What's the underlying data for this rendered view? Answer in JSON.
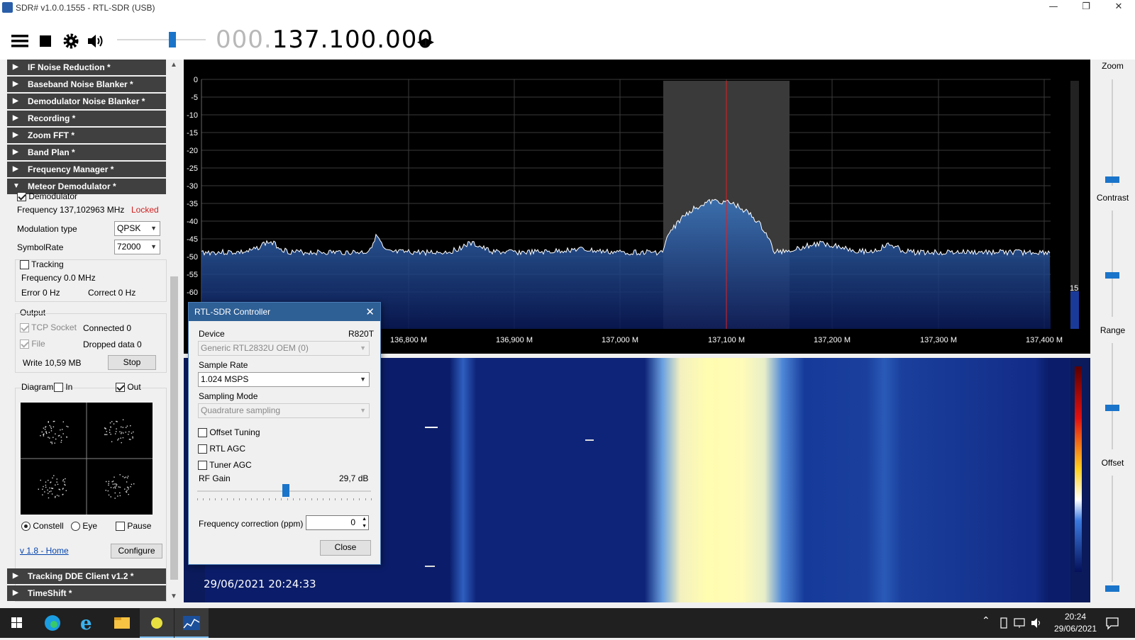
{
  "window": {
    "title": "SDR# v1.0.0.1555 - RTL-SDR (USB)",
    "controls": [
      "—",
      "❐",
      "✕"
    ]
  },
  "toolbar": {
    "icons": [
      "menu-icon",
      "stop-icon",
      "gear-icon",
      "speaker-icon"
    ],
    "frequency_dim": "000.",
    "frequency_main": "137.100.000",
    "tune_arrows": "◂▸"
  },
  "left_panel": {
    "sections_top": [
      {
        "label": "IF Noise Reduction *",
        "expanded": false
      },
      {
        "label": "Baseband Noise Blanker *",
        "expanded": false
      },
      {
        "label": "Demodulator Noise Blanker *",
        "expanded": false
      },
      {
        "label": "Recording *",
        "expanded": false
      },
      {
        "label": "Zoom FFT *",
        "expanded": false
      },
      {
        "label": "Band Plan *",
        "expanded": false
      },
      {
        "label": "Frequency Manager *",
        "expanded": false
      },
      {
        "label": "Meteor Demodulator *",
        "expanded": true
      }
    ],
    "meteor": {
      "demodulator_label": "Demodulator",
      "demodulator_checked": true,
      "frequency_text": "Frequency 137,102963 MHz",
      "locked_text": "Locked",
      "locked_color": "#d22020",
      "modulation_label": "Modulation type",
      "modulation_value": "QPSK",
      "symbolrate_label": "SymbolRate",
      "symbolrate_value": "72000",
      "tracking_label": "Tracking",
      "tracking_frequency": "Frequency 0.0 MHz",
      "tracking_error": "Error 0 Hz",
      "tracking_correct": "Correct 0 Hz",
      "output_label": "Output",
      "tcp_label": "TCP Socket",
      "tcp_status": "Connected 0",
      "file_label": "File",
      "file_status": "Dropped data 0",
      "write_text": "Write 10,59 MB",
      "stop_label": "Stop",
      "diagram_label": "Diagram",
      "in_label": "In",
      "out_label": "Out",
      "constell_label": "Constell",
      "eye_label": "Eye",
      "pause_label": "Pause",
      "home_link": "v 1.8 - Home",
      "configure_label": "Configure"
    },
    "sections_bottom": [
      {
        "label": "Tracking DDE Client v1.2 *"
      },
      {
        "label": "TimeShift *"
      }
    ]
  },
  "spectrum": {
    "y_ticks": [
      "0",
      "-5",
      "-10",
      "-15",
      "-20",
      "-25",
      "-30",
      "-35",
      "-40",
      "-45",
      "-50",
      "-55",
      "-60"
    ],
    "x_ticks": [
      "136,800 M",
      "136,900 M",
      "137,000 M",
      "137,100 M",
      "137,200 M",
      "137,300 M",
      "137,400 M"
    ],
    "side_value": "15"
  },
  "waterfall": {
    "timestamp": "29/06/2021 20:24:33"
  },
  "right_panel": {
    "zoom_label": "Zoom",
    "contrast_label": "Contrast",
    "range_label": "Range",
    "offset_label": "Offset"
  },
  "dialog": {
    "title": "RTL-SDR Controller",
    "device_label": "Device",
    "device_tuner": "R820T",
    "device_value": "Generic RTL2832U OEM (0)",
    "sample_rate_label": "Sample Rate",
    "sample_rate_value": "1.024 MSPS",
    "sampling_mode_label": "Sampling Mode",
    "sampling_mode_value": "Quadrature sampling",
    "offset_tuning_label": "Offset Tuning",
    "rtl_agc_label": "RTL AGC",
    "tuner_agc_label": "Tuner AGC",
    "rf_gain_label": "RF Gain",
    "rf_gain_value": "29,7 dB",
    "rf_gain_fraction": 0.51,
    "freq_corr_label": "Frequency correction (ppm)",
    "freq_corr_value": "0",
    "close_label": "Close"
  },
  "taskbar": {
    "time": "20:24",
    "date": "29/06/2021",
    "apps": [
      "windows-start-icon",
      "edge-icon",
      "ie-icon",
      "file-explorer-icon",
      "yellow-ball-app-icon",
      "sdrsharp-app-icon"
    ],
    "tray_icons": [
      "chevron-up-icon",
      "usb-drive-icon",
      "network-icon",
      "volume-icon"
    ]
  }
}
